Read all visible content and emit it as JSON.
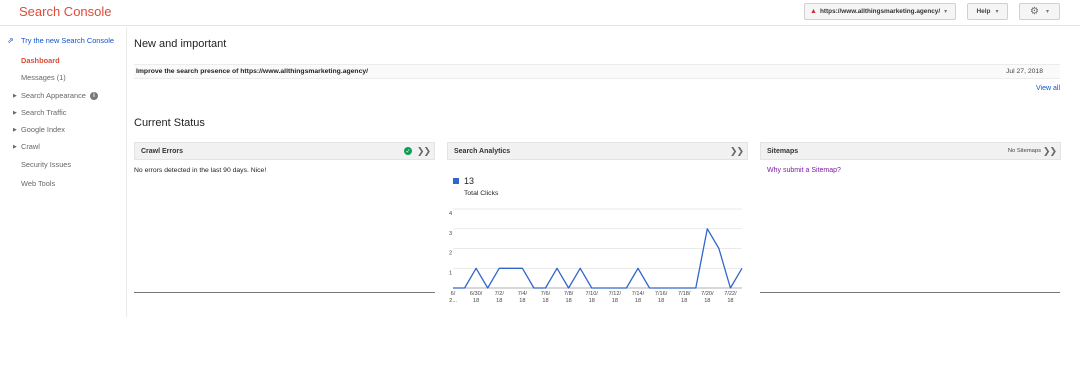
{
  "header": {
    "app_title": "Search Console",
    "property": "https://www.allthingsmarketing.agency/",
    "help_label": "Help"
  },
  "sidebar": {
    "new_console_link": "Try the new Search Console",
    "items": [
      {
        "label": "Dashboard",
        "active": true,
        "expandable": false
      },
      {
        "label": "Messages (1)",
        "active": false,
        "expandable": false
      },
      {
        "label": "Search Appearance",
        "active": false,
        "expandable": true
      },
      {
        "label": "Search Traffic",
        "active": false,
        "expandable": true
      },
      {
        "label": "Google Index",
        "active": false,
        "expandable": true
      },
      {
        "label": "Crawl",
        "active": false,
        "expandable": true
      },
      {
        "label": "Security Issues",
        "active": false,
        "expandable": false
      },
      {
        "label": "Web Tools",
        "active": false,
        "expandable": false
      }
    ]
  },
  "main": {
    "new_and_important": {
      "title": "New and important",
      "message": "Improve the search presence of https://www.allthingsmarketing.agency/",
      "date": "Jul 27, 2018",
      "view_all": "View all"
    },
    "current_status": {
      "title": "Current Status",
      "crawl_errors": {
        "title": "Crawl Errors",
        "text": "No errors detected in the last 90 days. Nice!"
      },
      "search_analytics": {
        "title": "Search Analytics",
        "total_value": "13",
        "total_label": "Total Clicks"
      },
      "sitemaps": {
        "title": "Sitemaps",
        "status": "No Sitemaps",
        "link": "Why submit a Sitemap?"
      }
    }
  },
  "colors": {
    "brand": "#dd4b39",
    "link": "#1155cc",
    "series": "#3366cc",
    "visited_link": "#7b1fa2",
    "ok": "#0f9d58"
  },
  "chart_data": {
    "type": "line",
    "title": "",
    "xlabel": "",
    "ylabel": "",
    "ylim": [
      0,
      4
    ],
    "y_ticks": [
      1,
      2,
      3,
      4
    ],
    "x_tick_labels": [
      [
        "6/",
        "2..."
      ],
      [
        "6/30/",
        "18"
      ],
      [
        "7/2/",
        "18"
      ],
      [
        "7/4/",
        "18"
      ],
      [
        "7/6/",
        "18"
      ],
      [
        "7/8/",
        "18"
      ],
      [
        "7/10/",
        "18"
      ],
      [
        "7/12/",
        "18"
      ],
      [
        "7/14/",
        "18"
      ],
      [
        "7/16/",
        "18"
      ],
      [
        "7/18/",
        "18"
      ],
      [
        "7/20/",
        "18"
      ],
      [
        "7/22/",
        "18"
      ],
      [
        "7/24/",
        "18"
      ]
    ],
    "series": [
      {
        "name": "Total Clicks",
        "values": [
          0,
          0,
          1,
          0,
          1,
          1,
          1,
          0,
          0,
          1,
          0,
          1,
          0,
          0,
          0,
          0,
          1,
          0,
          0,
          0,
          0,
          0,
          3,
          2,
          0,
          1
        ]
      }
    ]
  }
}
